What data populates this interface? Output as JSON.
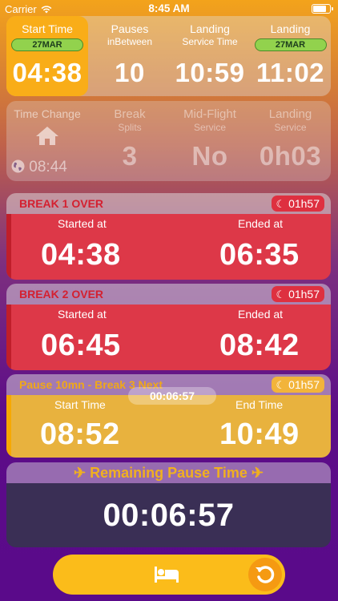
{
  "status_bar": {
    "carrier": "Carrier",
    "time": "8:45 AM"
  },
  "row1": {
    "start_time": {
      "label": "Start Time",
      "date": "27MAR",
      "value": "04:38"
    },
    "pauses": {
      "label": "Pauses",
      "sublabel": "inBetween",
      "value": "10"
    },
    "landing_service": {
      "label": "Landing",
      "sublabel": "Service Time",
      "value": "10:59"
    },
    "landing": {
      "label": "Landing",
      "date": "27MAR",
      "value": "11:02"
    }
  },
  "row2": {
    "time_change": {
      "label": "Time Change",
      "value": "08:44"
    },
    "break_splits": {
      "label": "Break",
      "sublabel": "Splits",
      "value": "3"
    },
    "mid_flight": {
      "label": "Mid-Flight",
      "sublabel": "Service",
      "value": "No"
    },
    "landing_service": {
      "label": "Landing",
      "sublabel": "Service",
      "value": "0h03"
    }
  },
  "breaks": [
    {
      "title": "BREAK 1 OVER",
      "duration": "01h57",
      "left_label": "Started at",
      "left_value": "04:38",
      "right_label": "Ended at",
      "right_value": "06:35"
    },
    {
      "title": "BREAK 2 OVER",
      "duration": "01h57",
      "left_label": "Started at",
      "left_value": "06:45",
      "right_label": "Ended at",
      "right_value": "08:42"
    },
    {
      "title": "Pause 10mn - Break 3 Next",
      "duration": "01h57",
      "left_label": "Start Time",
      "left_value": "08:52",
      "countdown": "00:06:57",
      "right_label": "End Time",
      "right_value": "10:49"
    }
  ],
  "remaining": {
    "title": "✈ Remaining Pause Time ✈",
    "value": "00:06:57"
  },
  "icons": {
    "home": "home-icon",
    "globe": "globe-icon",
    "moon": "moon-icon",
    "bed": "bed-icon",
    "reset": "reset-icon"
  },
  "colors": {
    "accent": "#f9ad18",
    "break_over": "#dd3848",
    "current_pause": "#e8b23e",
    "remaining_bg": "#3a2f55"
  }
}
